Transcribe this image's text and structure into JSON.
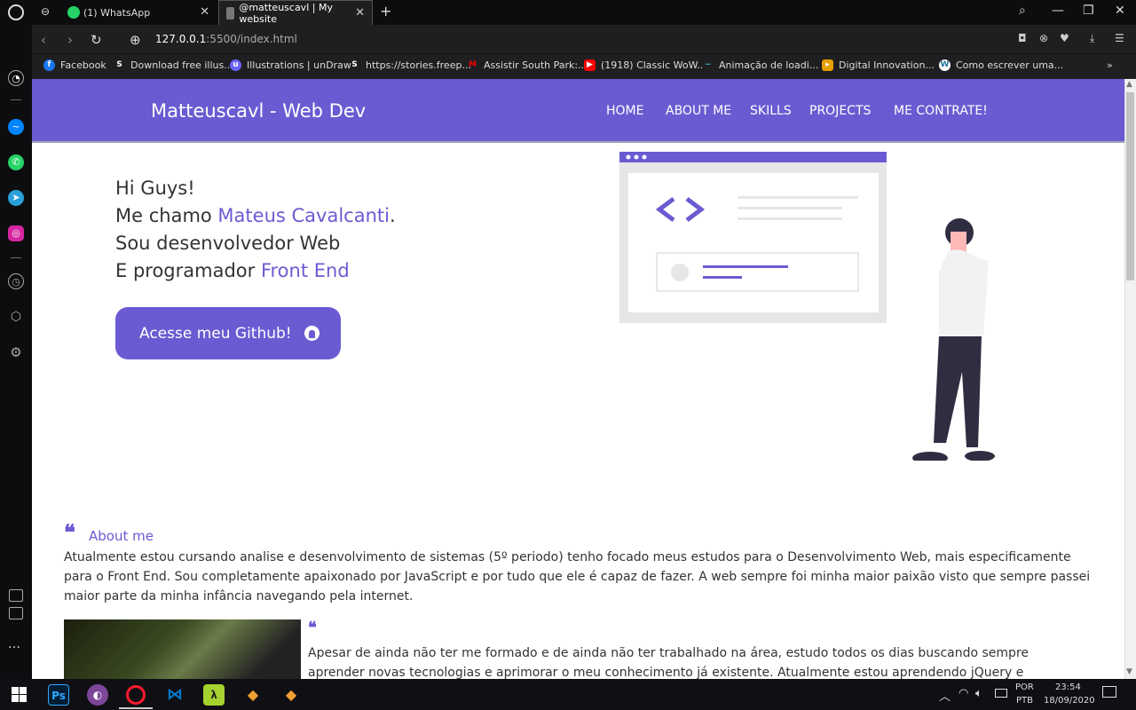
{
  "browser": {
    "tabs": [
      {
        "title": "(1) WhatsApp",
        "active": false
      },
      {
        "title": "@matteuscavl | My website",
        "active": true
      }
    ],
    "url_host": "127.0.0.1",
    "url_path": ":5500/index.html",
    "bookmarks": [
      {
        "label": "Facebook",
        "icon": "facebook-icon",
        "color": "#1877f2"
      },
      {
        "label": "Download free illus...",
        "icon": "storyset-icon",
        "color": "#333"
      },
      {
        "label": "Illustrations | unDraw",
        "icon": "undraw-icon",
        "color": "#6c63ff"
      },
      {
        "label": "https://stories.freep...",
        "icon": "storyset-icon",
        "color": "#333"
      },
      {
        "label": "Assistir South Park:...",
        "icon": "megaflix-icon",
        "color": "#c00"
      },
      {
        "label": "(1918) Classic WoW...",
        "icon": "youtube-icon",
        "color": "#f00"
      },
      {
        "label": "Animação de loadi...",
        "icon": "loading-icon",
        "color": "#3a6"
      },
      {
        "label": "Digital Innovation...",
        "icon": "dio-icon",
        "color": "#e8a000"
      },
      {
        "label": "Como escrever uma...",
        "icon": "wordpress-icon",
        "color": "#21759b"
      }
    ]
  },
  "site": {
    "brand": "Matteuscavl - Web Dev",
    "menu": [
      "HOME",
      "ABOUT ME",
      "SKILLS",
      "PROJECTS",
      "ME CONTRATE!"
    ],
    "hero": {
      "line1": "Hi Guys!",
      "line2_prefix": "Me chamo ",
      "line2_name": "Mateus Cavalcanti",
      "line2_suffix": ".",
      "line3": "Sou desenvolvedor Web",
      "line4_prefix": "E programador ",
      "line4_highlight": "Front End"
    },
    "github_button": "Acesse meu Github!",
    "about_quote": "❝",
    "about_title": "About me",
    "about_text": "Atualmente estou cursando analise e desenvolvimento de sistemas (5º periodo) tenho focado meus estudos para o Desenvolvimento Web, mais especificamente para o Front End. Sou completamente apaixonado por JavaScript e por tudo que ele é capaz de fazer. A web sempre foi minha maior paixão visto que sempre passei maior parte da minha infância navegando pela internet.",
    "about_text2": "Apesar de ainda não ter me formado e de ainda não ter trabalhado na área, estudo todos os dias buscando sempre aprender novas tecnologias e aprimorar o meu conhecimento já existente. Atualmente estou aprendendo jQuery e"
  },
  "taskbar": {
    "lang1": "POR",
    "lang2": "PTB",
    "time": "23:54",
    "date": "18/09/2020"
  },
  "colors": {
    "accent": "#6b5bd2"
  }
}
